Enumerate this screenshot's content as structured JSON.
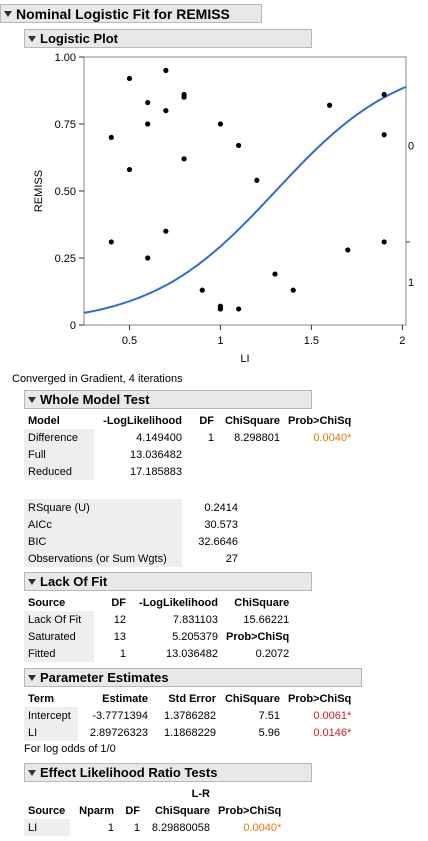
{
  "report": {
    "title": "Nominal Logistic Fit for REMISS",
    "converged": "Converged in Gradient, 4 iterations",
    "log_odds_note": "For log odds of 1/0"
  },
  "logistic_plot": {
    "title": "Logistic Plot",
    "right_labels": [
      "0",
      "1"
    ]
  },
  "chart_data": {
    "type": "scatter",
    "title": "",
    "xlabel": "LI",
    "ylabel": "REMISS",
    "xlim": [
      0.25,
      2.02
    ],
    "ylim": [
      0,
      1
    ],
    "xticks": [
      "0.5",
      "1",
      "1.5",
      "2"
    ],
    "yticks": [
      "0",
      "0.25",
      "0.50",
      "0.75",
      "1.00"
    ],
    "grid": false,
    "curve": {
      "type": "logistic",
      "intercept": -3.7771394,
      "slope": 2.89726323,
      "color": "#2e6bd9"
    },
    "points": {
      "x": [
        0.4,
        0.4,
        0.5,
        0.5,
        0.6,
        0.6,
        0.6,
        0.7,
        0.7,
        0.7,
        0.8,
        0.8,
        0.8,
        0.9,
        1.0,
        1.0,
        1.0,
        1.0,
        1.1,
        1.1,
        1.2,
        1.3,
        1.4,
        1.6,
        1.7,
        1.9,
        1.9,
        1.9
      ],
      "y": [
        0.7,
        0.31,
        0.92,
        0.58,
        0.83,
        0.75,
        0.25,
        0.95,
        0.8,
        0.35,
        0.86,
        0.85,
        0.62,
        0.13,
        0.75,
        0.07,
        0.06,
        0.06,
        0.67,
        0.06,
        0.54,
        0.19,
        0.13,
        0.82,
        0.28,
        0.86,
        0.71,
        0.31
      ]
    }
  },
  "whole_model": {
    "title": "Whole Model Test",
    "headers": [
      "Model",
      "-LogLikelihood",
      "DF",
      "ChiSquare",
      "Prob>ChiSq"
    ],
    "rows": [
      [
        "Difference",
        "4.149400",
        "1",
        "8.298801",
        "0.0040*"
      ],
      [
        "Full",
        "13.036482",
        "",
        "",
        ""
      ],
      [
        "Reduced",
        "17.185883",
        "",
        "",
        ""
      ]
    ]
  },
  "summary_stats": {
    "rows": [
      [
        "RSquare (U)",
        "0.2414"
      ],
      [
        "AICc",
        "30.573"
      ],
      [
        "BIC",
        "32.6646"
      ],
      [
        "Observations (or Sum Wgts)",
        "27"
      ]
    ]
  },
  "lack_of_fit": {
    "title": "Lack Of Fit",
    "headers": [
      "Source",
      "DF",
      "-LogLikelihood",
      "ChiSquare"
    ],
    "rows": [
      [
        "Lack Of Fit",
        "12",
        "7.831103",
        "15.66221"
      ],
      [
        "Saturated",
        "13",
        "5.205379",
        "Prob>ChiSq"
      ],
      [
        "Fitted",
        "1",
        "13.036482",
        "0.2072"
      ]
    ]
  },
  "param_estimates": {
    "title": "Parameter Estimates",
    "headers": [
      "Term",
      "Estimate",
      "Std Error",
      "ChiSquare",
      "Prob>ChiSq"
    ],
    "rows": [
      [
        "Intercept",
        "-3.7771394",
        "1.3786282",
        "7.51",
        "0.0061*"
      ],
      [
        "LI",
        "2.89726323",
        "1.1868229",
        "5.96",
        "0.0146*"
      ]
    ]
  },
  "effect_lr": {
    "title": "Effect Likelihood Ratio Tests",
    "header_top": "L-R",
    "headers": [
      "Source",
      "Nparm",
      "DF",
      "ChiSquare",
      "Prob>ChiSq"
    ],
    "rows": [
      [
        "LI",
        "1",
        "1",
        "8.29880058",
        "0.0040*"
      ]
    ]
  },
  "colors": {
    "accent_orange": "#e07a10",
    "accent_red": "#d02020",
    "curve_blue": "#2e6bd9"
  }
}
